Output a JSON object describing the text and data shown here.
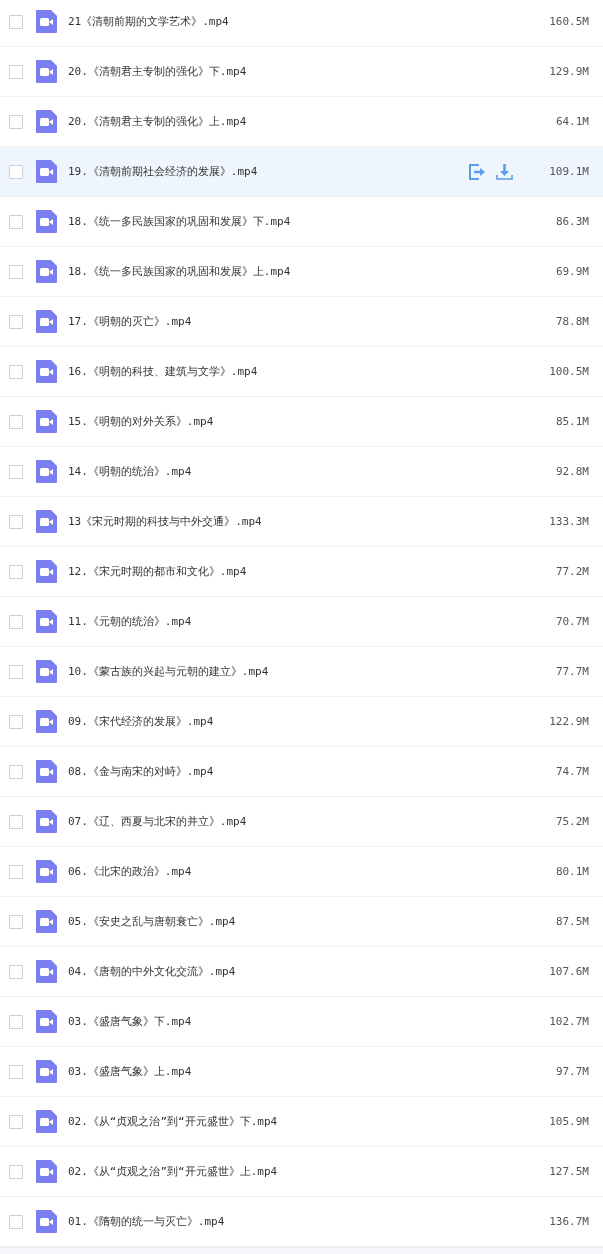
{
  "files": [
    {
      "name": "21《清朝前期的文学艺术》.mp4",
      "size": "160.5M",
      "checked": false,
      "hovered": false
    },
    {
      "name": "20.《清朝君主专制的强化》下.mp4",
      "size": "129.9M",
      "checked": false,
      "hovered": false
    },
    {
      "name": "20.《清朝君主专制的强化》上.mp4",
      "size": "64.1M",
      "checked": false,
      "hovered": false
    },
    {
      "name": "19.《清朝前期社会经济的发展》.mp4",
      "size": "109.1M",
      "checked": false,
      "hovered": true
    },
    {
      "name": "18.《统一多民族国家的巩固和发展》下.mp4",
      "size": "86.3M",
      "checked": false,
      "hovered": false
    },
    {
      "name": "18.《统一多民族国家的巩固和发展》上.mp4",
      "size": "69.9M",
      "checked": false,
      "hovered": false
    },
    {
      "name": "17.《明朝的灭亡》.mp4",
      "size": "78.8M",
      "checked": false,
      "hovered": false
    },
    {
      "name": "16.《明朝的科技、建筑与文学》.mp4",
      "size": "100.5M",
      "checked": false,
      "hovered": false
    },
    {
      "name": "15.《明朝的对外关系》.mp4",
      "size": "85.1M",
      "checked": false,
      "hovered": false
    },
    {
      "name": "14.《明朝的统治》.mp4",
      "size": "92.8M",
      "checked": false,
      "hovered": false
    },
    {
      "name": "13《宋元时期的科技与中外交通》.mp4",
      "size": "133.3M",
      "checked": false,
      "hovered": false
    },
    {
      "name": "12.《宋元时期的都市和文化》.mp4",
      "size": "77.2M",
      "checked": false,
      "hovered": false
    },
    {
      "name": "11.《元朝的统治》.mp4",
      "size": "70.7M",
      "checked": false,
      "hovered": false
    },
    {
      "name": "10.《蒙古族的兴起与元朝的建立》.mp4",
      "size": "77.7M",
      "checked": false,
      "hovered": false
    },
    {
      "name": "09.《宋代经济的发展》.mp4",
      "size": "122.9M",
      "checked": false,
      "hovered": false
    },
    {
      "name": "08.《金与南宋的对峙》.mp4",
      "size": "74.7M",
      "checked": false,
      "hovered": false
    },
    {
      "name": "07.《辽、西夏与北宋的并立》.mp4",
      "size": "75.2M",
      "checked": false,
      "hovered": false
    },
    {
      "name": "06.《北宋的政治》.mp4",
      "size": "80.1M",
      "checked": false,
      "hovered": false
    },
    {
      "name": "05.《安史之乱与唐朝衰亡》.mp4",
      "size": "87.5M",
      "checked": false,
      "hovered": false
    },
    {
      "name": "04.《唐朝的中外文化交流》.mp4",
      "size": "107.6M",
      "checked": false,
      "hovered": false
    },
    {
      "name": "03.《盛唐气象》下.mp4",
      "size": "102.7M",
      "checked": false,
      "hovered": false
    },
    {
      "name": "03.《盛唐气象》上.mp4",
      "size": "97.7M",
      "checked": false,
      "hovered": false
    },
    {
      "name": "02.《从“贞观之治”到“开元盛世》下.mp4",
      "size": "105.9M",
      "checked": false,
      "hovered": false
    },
    {
      "name": "02.《从“贞观之治”到“开元盛世》上.mp4",
      "size": "127.5M",
      "checked": false,
      "hovered": false
    },
    {
      "name": "01.《隋朝的统一与灭亡》.mp4",
      "size": "136.7M",
      "checked": false,
      "hovered": false
    }
  ]
}
